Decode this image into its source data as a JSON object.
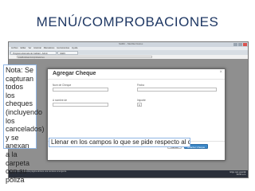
{
  "slide": {
    "title": "MENÚ/COMPROBACIONES"
  },
  "browser": {
    "window_title": "SARC - Mozilla Firefox",
    "menu": [
      "Archivo",
      "Editar",
      "Ver",
      "Historial",
      "Marcadores",
      "Herramientas",
      "Ayuda"
    ],
    "tabs": [
      "Programa Escuela de Calidad - Admin",
      "SARC"
    ],
    "url": "localhost/sarc/comprobaciones"
  },
  "modal": {
    "title": "Agregar Cheque",
    "close_glyph": "×",
    "fields": {
      "cheque_label": "Num de Cheque",
      "fecha_label": "Fecha",
      "importe_label": "A nombre de",
      "importe2_label": "Importe",
      "importe2_value": "0"
    },
    "buttons": {
      "cancel": "Cancel",
      "save": "Guardar Cheque"
    }
  },
  "statusbar": {
    "left": "Firefox evitó que esta página abriera una ventana emergente.",
    "right_top": "Elige qué guardar",
    "clock": "09:00 a.m."
  },
  "note": {
    "text": "Nota: Se capturan todos los cheques (incluyendo los cancelados) y se anexan a la carpeta con su póliza"
  },
  "caption": {
    "text": "Llenar en los campos lo que se pide respecto al cheque ejercido"
  }
}
